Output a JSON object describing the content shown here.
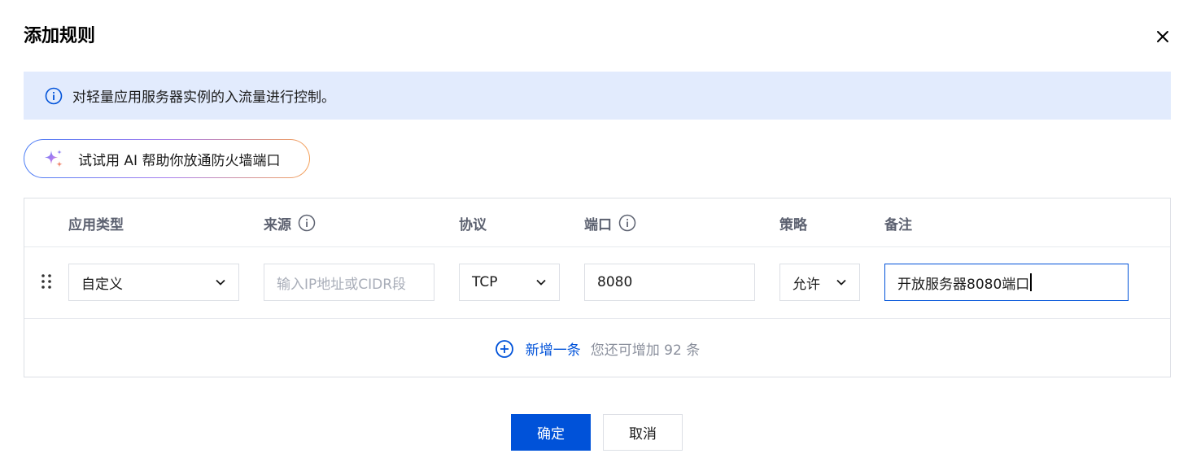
{
  "dialog": {
    "title": "添加规则"
  },
  "info_banner": {
    "text": "对轻量应用服务器实例的入流量进行控制。"
  },
  "ai_button": {
    "label": "试试用 AI 帮助你放通防火墙端口"
  },
  "table": {
    "headers": {
      "app_type": "应用类型",
      "source": "来源",
      "protocol": "协议",
      "port": "端口",
      "policy": "策略",
      "remark": "备注"
    },
    "rows": [
      {
        "app_type": "自定义",
        "source_value": "",
        "source_placeholder": "输入IP地址或CIDR段",
        "protocol": "TCP",
        "port": "8080",
        "policy": "允许",
        "remark": "开放服务器8080端口"
      }
    ],
    "add_label": "新增一条",
    "add_hint": "您还可增加 92 条"
  },
  "footer": {
    "confirm_label": "确定",
    "cancel_label": "取消"
  },
  "colors": {
    "primary": "#0052d9",
    "banner_bg": "#e2ebfd",
    "border": "#dcdfe5",
    "header_text": "#5c6170"
  },
  "icons": {
    "close": "close-icon",
    "info": "info-icon",
    "sparkle": "sparkle-icon",
    "help": "help-icon",
    "drag": "drag-handle-icon",
    "chevron": "chevron-down-icon",
    "add": "plus-circle-icon"
  }
}
